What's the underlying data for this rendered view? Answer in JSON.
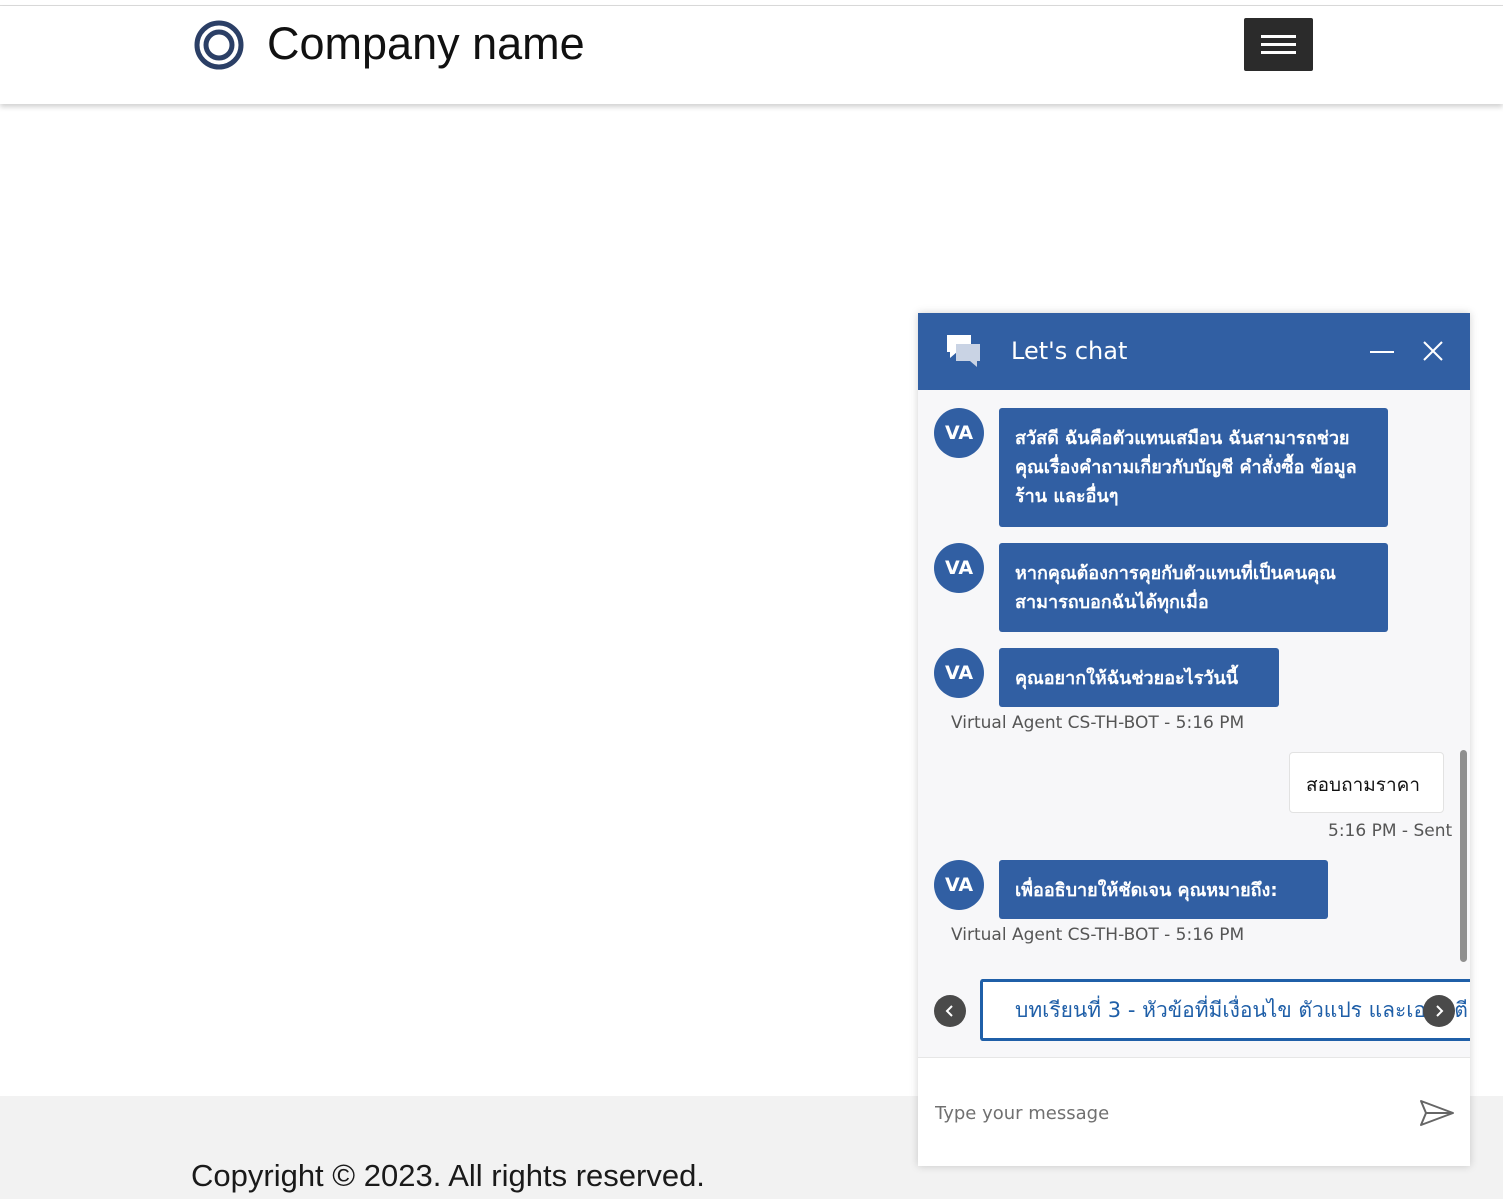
{
  "header": {
    "company_name": "Company name",
    "menu_icon": "hamburger-menu-icon",
    "logo_icon": "ring-logo-icon"
  },
  "footer": {
    "copyright": "Copyright © 2023. All rights reserved."
  },
  "chat": {
    "title": "Let's chat",
    "icons": {
      "chat": "chat-bubbles-icon",
      "minimize": "minimize-icon",
      "close": "close-icon",
      "send": "send-icon",
      "prev": "chevron-left-icon",
      "next": "chevron-right-icon"
    },
    "colors": {
      "header": "#315fa3",
      "bubble": "#315fa3",
      "suggested_action": "#1f5fa8"
    },
    "messages": [
      {
        "avatar": "VA",
        "text": "สวัสดี ฉันคือตัวแทนเสมือน ฉันสามารถช่วยคุณเรื่องคำถามเกี่ยวกับบัญชี คำสั่งซื้อ ข้อมูลร้าน และอื่นๆ"
      },
      {
        "avatar": "VA",
        "text": "หากคุณต้องการคุยกับตัวแทนที่เป็นคนคุณสามารถบอกฉันได้ทุกเมื่อ"
      },
      {
        "avatar": "VA",
        "text": "คุณอยากให้ฉันช่วยอะไรวันนี้",
        "meta": "Virtual Agent CS-TH-BOT - 5:16 PM"
      },
      {
        "from": "user",
        "text": "สอบถามราคา",
        "meta": "5:16 PM - Sent"
      },
      {
        "avatar": "VA",
        "text": "เพื่ออธิบายให้ชัดเจน คุณหมายถึง:",
        "meta": "Virtual Agent CS-TH-BOT - 5:16 PM"
      }
    ],
    "suggested_action": "บทเรียนที่ 3 - หัวข้อที่มีเงื่อนไข ตัวแปร และเอนทิตี",
    "input": {
      "placeholder": "Type your message",
      "value": ""
    }
  }
}
